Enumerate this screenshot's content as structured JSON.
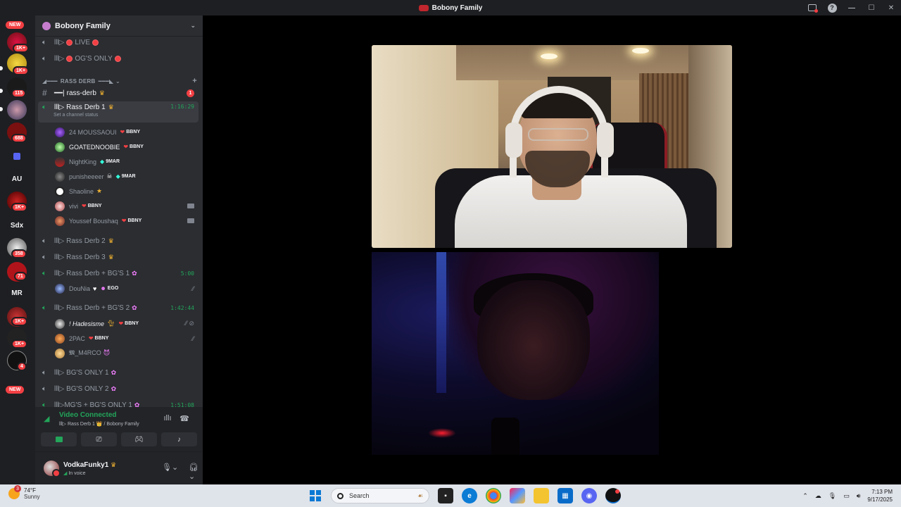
{
  "window": {
    "title": "Bobony Family"
  },
  "rail": {
    "items": [
      {
        "label": "NEW",
        "kind": "new-pill"
      },
      {
        "badge": "1K+"
      },
      {
        "badge": "1K+"
      },
      {
        "badge": "115"
      },
      {
        "badge": "688"
      },
      {
        "label": "AU"
      },
      {
        "badge": "1K+"
      },
      {
        "label": "Sdx"
      },
      {
        "badge": "358"
      },
      {
        "badge": "71"
      },
      {
        "label": "MR"
      },
      {
        "badge": "1K+"
      },
      {
        "badge": "1K+"
      },
      {
        "badge": "4"
      },
      {
        "label": "NEW",
        "kind": "new-pill"
      }
    ]
  },
  "server": {
    "name": "Bobony Family"
  },
  "channels": {
    "live": "lll▷",
    "live_name": "LIVE",
    "ogs_prefix": "lll▷",
    "ogs_name": "OG'S ONLY",
    "category": "RASS DERB",
    "text_channel": "rass-derb",
    "text_mention": "1",
    "rd1_name": "lll▷ Rass Derb 1",
    "rd1_time": "1:16:29",
    "rd1_status": "Set a channel status",
    "rd2_name": "lll▷ Rass Derb 2",
    "rd3_name": "lll▷ Rass Derb 3",
    "rdbg1_name": "lll▷ Rass Derb + BG'S 1",
    "rdbg1_time": "5:00",
    "rdbg2_name": "lll▷ Rass Derb + BG'S 2",
    "rdbg2_time": "1:42:44",
    "bg1_name": "lll▷ BG'S ONLY 1",
    "bg2_name": "lll▷ BG'S ONLY 2",
    "mgbg_name": "lll▷MG'S + BG'S ONLY 1",
    "mgbg_time": "1:51:08"
  },
  "users": {
    "u1_name": "24 MOUSSAOUI",
    "u1_tag": "BBNY",
    "u2_name": "GOATEDNOOBIE",
    "u2_tag": "BBNY",
    "u3_name": "NightKing",
    "u3_tag": "9MAR",
    "u4_name": "punisheeeer",
    "u4_tag": "9MAR",
    "u5_name": "Shaoline",
    "u6_name": "vivi",
    "u6_tag": "BBNY",
    "u7_name": "Youssef Boushaq",
    "u7_tag": "BBNY",
    "u8_name": "DouNia",
    "u8_tag": "EGO",
    "u9_name": "! Hadesisme",
    "u9_tag": "BBNY",
    "u10_name": "2PAC",
    "u10_tag": "BBNY",
    "u11_name": "𝕸_M4RCO"
  },
  "voice": {
    "status": "Video Connected",
    "location": "lll▷ Rass Derb 1 👑 / Bobony Family"
  },
  "account": {
    "username": "VodkaFunky1",
    "status": "In voice"
  },
  "taskbar": {
    "temperature": "74°F",
    "condition": "Sunny",
    "weather_badge": "3",
    "search_placeholder": "Search",
    "time": "7:13 PM",
    "date": "9/17/2025"
  },
  "colors": {
    "accent_green": "#23a55a",
    "danger_red": "#f23f43",
    "crown_gold": "#f0b232"
  }
}
